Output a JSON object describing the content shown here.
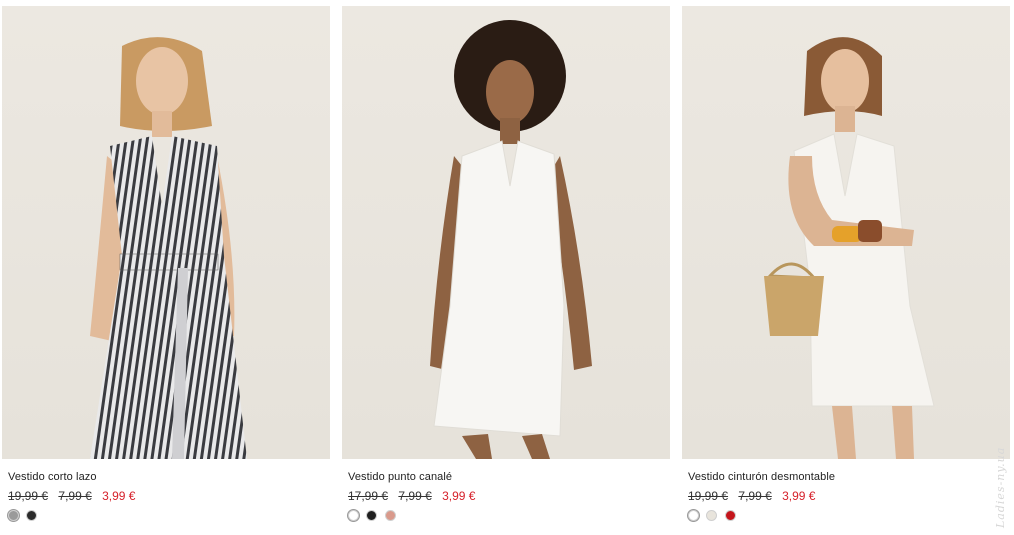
{
  "products": [
    {
      "name": "Vestido corto lazo",
      "original_price": "19,99 €",
      "previous_price": "7,99 €",
      "sale_price": "3,99 €",
      "colors": [
        "#9a9a9a",
        "#2b2b2b"
      ]
    },
    {
      "name": "Vestido punto canalé",
      "original_price": "17,99 €",
      "previous_price": "7,99 €",
      "sale_price": "3,99 €",
      "colors": [
        "#ffffff",
        "#1f1f1f",
        "#d99a8c"
      ]
    },
    {
      "name": "Vestido cinturón desmontable",
      "original_price": "19,99 €",
      "previous_price": "7,99 €",
      "sale_price": "3,99 €",
      "colors": [
        "#ffffff",
        "#e8e4dc",
        "#c4151c"
      ]
    }
  ],
  "watermark": "Ladies-ny.ua",
  "accent_colors": {
    "sale": "#d6212b",
    "background": "#ece8e1"
  }
}
